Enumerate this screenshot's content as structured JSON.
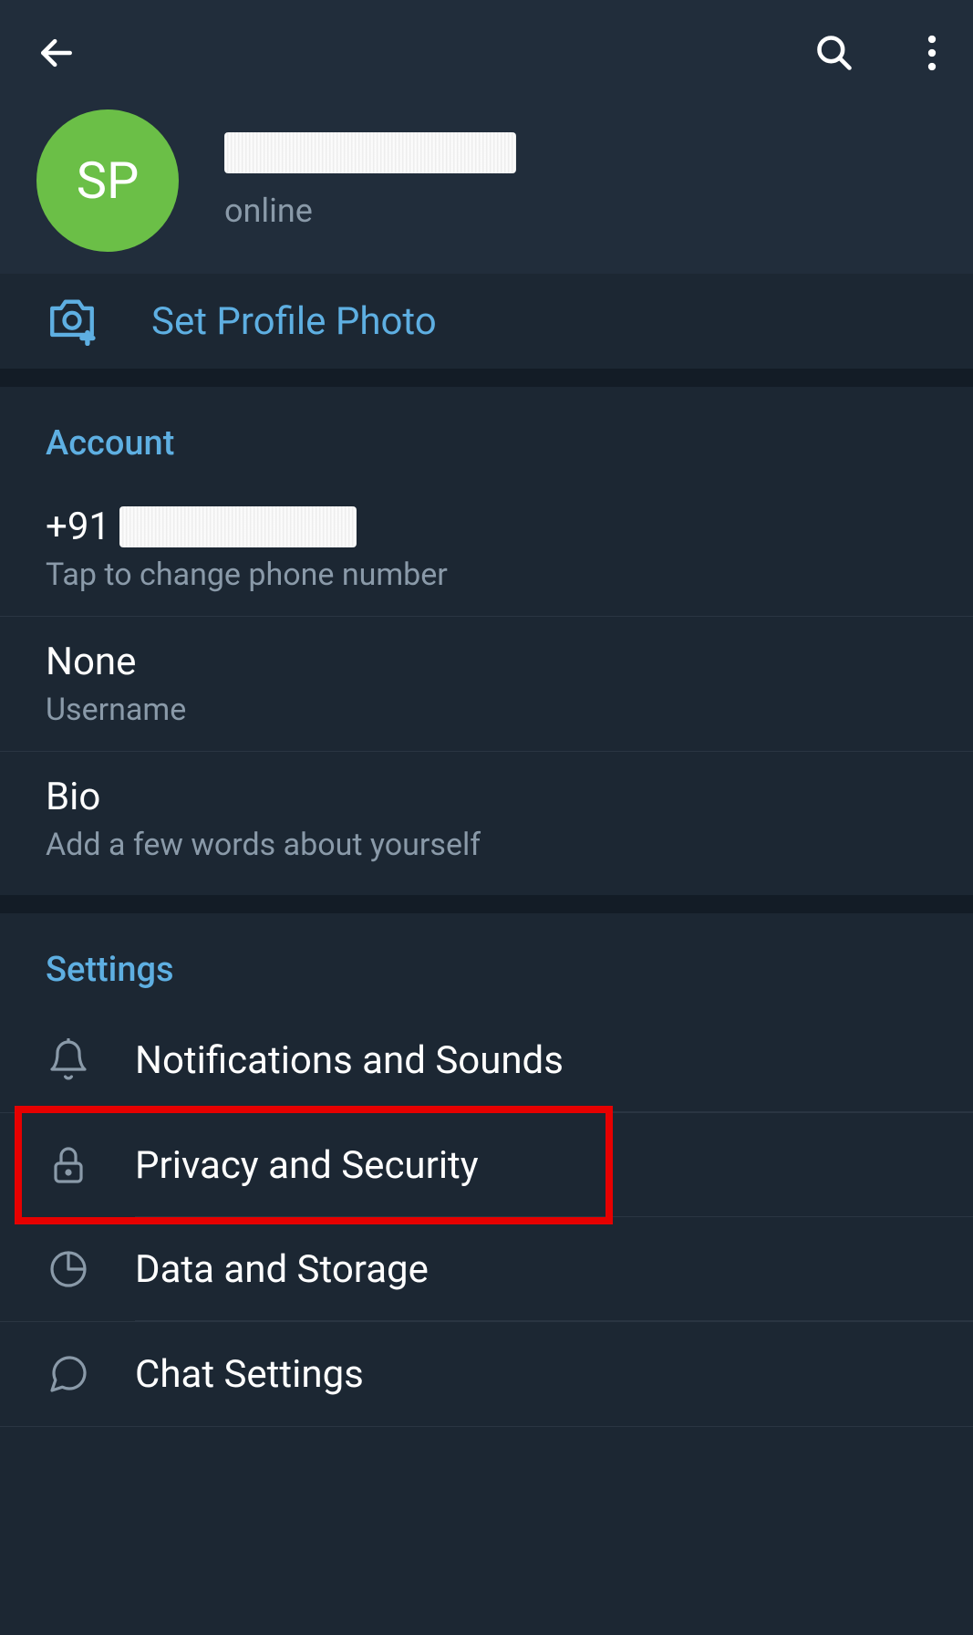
{
  "profile": {
    "avatar_initials": "SP",
    "status": "online",
    "set_photo_label": "Set Profile Photo"
  },
  "account": {
    "section_title": "Account",
    "phone_prefix": "+91",
    "phone_label": "Tap to change phone number",
    "username_value": "None",
    "username_label": "Username",
    "bio_value": "Bio",
    "bio_label": "Add a few words about yourself"
  },
  "settings": {
    "section_title": "Settings",
    "items": [
      {
        "label": "Notifications and Sounds"
      },
      {
        "label": "Privacy and Security"
      },
      {
        "label": "Data and Storage"
      },
      {
        "label": "Chat Settings"
      }
    ]
  }
}
